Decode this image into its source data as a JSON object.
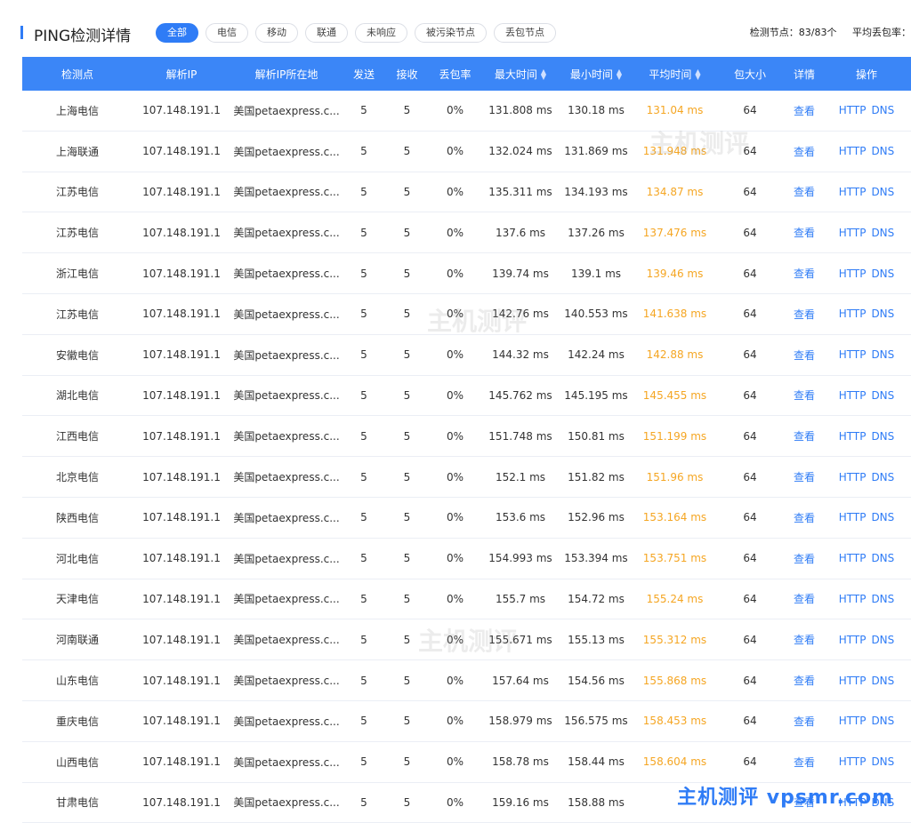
{
  "header": {
    "title": "PING检测详情",
    "filters": [
      "全部",
      "电信",
      "移动",
      "联通",
      "未响应",
      "被污染节点",
      "丢包节点"
    ],
    "active_filter": 0,
    "summary_nodes": "检测节点：83/83个",
    "summary_loss": "平均丢包率："
  },
  "table": {
    "columns": [
      "检测点",
      "解析IP",
      "解析IP所在地",
      "发送",
      "接收",
      "丢包率",
      "最大时间",
      "最小时间",
      "平均时间",
      "包大小",
      "详情",
      "操作"
    ],
    "detail_label": "查看",
    "action_http": "HTTP",
    "action_dns": "DNS",
    "rows": [
      [
        "上海电信",
        "107.148.191.1",
        "美国petaexpress.c...",
        "5",
        "5",
        "0%",
        "131.808 ms",
        "130.18 ms",
        "131.04 ms",
        "64"
      ],
      [
        "上海联通",
        "107.148.191.1",
        "美国petaexpress.c...",
        "5",
        "5",
        "0%",
        "132.024 ms",
        "131.869 ms",
        "131.948 ms",
        "64"
      ],
      [
        "江苏电信",
        "107.148.191.1",
        "美国petaexpress.c...",
        "5",
        "5",
        "0%",
        "135.311 ms",
        "134.193 ms",
        "134.87 ms",
        "64"
      ],
      [
        "江苏电信",
        "107.148.191.1",
        "美国petaexpress.c...",
        "5",
        "5",
        "0%",
        "137.6 ms",
        "137.26 ms",
        "137.476 ms",
        "64"
      ],
      [
        "浙江电信",
        "107.148.191.1",
        "美国petaexpress.c...",
        "5",
        "5",
        "0%",
        "139.74 ms",
        "139.1 ms",
        "139.46 ms",
        "64"
      ],
      [
        "江苏电信",
        "107.148.191.1",
        "美国petaexpress.c...",
        "5",
        "5",
        "0%",
        "142.76 ms",
        "140.553 ms",
        "141.638 ms",
        "64"
      ],
      [
        "安徽电信",
        "107.148.191.1",
        "美国petaexpress.c...",
        "5",
        "5",
        "0%",
        "144.32 ms",
        "142.24 ms",
        "142.88 ms",
        "64"
      ],
      [
        "湖北电信",
        "107.148.191.1",
        "美国petaexpress.c...",
        "5",
        "5",
        "0%",
        "145.762 ms",
        "145.195 ms",
        "145.455 ms",
        "64"
      ],
      [
        "江西电信",
        "107.148.191.1",
        "美国petaexpress.c...",
        "5",
        "5",
        "0%",
        "151.748 ms",
        "150.81 ms",
        "151.199 ms",
        "64"
      ],
      [
        "北京电信",
        "107.148.191.1",
        "美国petaexpress.c...",
        "5",
        "5",
        "0%",
        "152.1 ms",
        "151.82 ms",
        "151.96 ms",
        "64"
      ],
      [
        "陕西电信",
        "107.148.191.1",
        "美国petaexpress.c...",
        "5",
        "5",
        "0%",
        "153.6 ms",
        "152.96 ms",
        "153.164 ms",
        "64"
      ],
      [
        "河北电信",
        "107.148.191.1",
        "美国petaexpress.c...",
        "5",
        "5",
        "0%",
        "154.993 ms",
        "153.394 ms",
        "153.751 ms",
        "64"
      ],
      [
        "天津电信",
        "107.148.191.1",
        "美国petaexpress.c...",
        "5",
        "5",
        "0%",
        "155.7 ms",
        "154.72 ms",
        "155.24 ms",
        "64"
      ],
      [
        "河南联通",
        "107.148.191.1",
        "美国petaexpress.c...",
        "5",
        "5",
        "0%",
        "155.671 ms",
        "155.13 ms",
        "155.312 ms",
        "64"
      ],
      [
        "山东电信",
        "107.148.191.1",
        "美国petaexpress.c...",
        "5",
        "5",
        "0%",
        "157.64 ms",
        "154.56 ms",
        "155.868 ms",
        "64"
      ],
      [
        "重庆电信",
        "107.148.191.1",
        "美国petaexpress.c...",
        "5",
        "5",
        "0%",
        "158.979 ms",
        "156.575 ms",
        "158.453 ms",
        "64"
      ],
      [
        "山西电信",
        "107.148.191.1",
        "美国petaexpress.c...",
        "5",
        "5",
        "0%",
        "158.78 ms",
        "158.44 ms",
        "158.604 ms",
        "64"
      ],
      [
        "甘肃电信",
        "107.148.191.1",
        "美国petaexpress.c...",
        "5",
        "5",
        "0%",
        "159.16 ms",
        "158.88 ms",
        "",
        ""
      ]
    ]
  },
  "watermark": {
    "domain": "VPSMR.COM",
    "text": "主机测评"
  },
  "brand": "主机测评 vpsmr.com",
  "colors": {
    "accent": "#2f7cf6",
    "header_bg": "#3b86f7",
    "avg_time": "#f5a623"
  }
}
